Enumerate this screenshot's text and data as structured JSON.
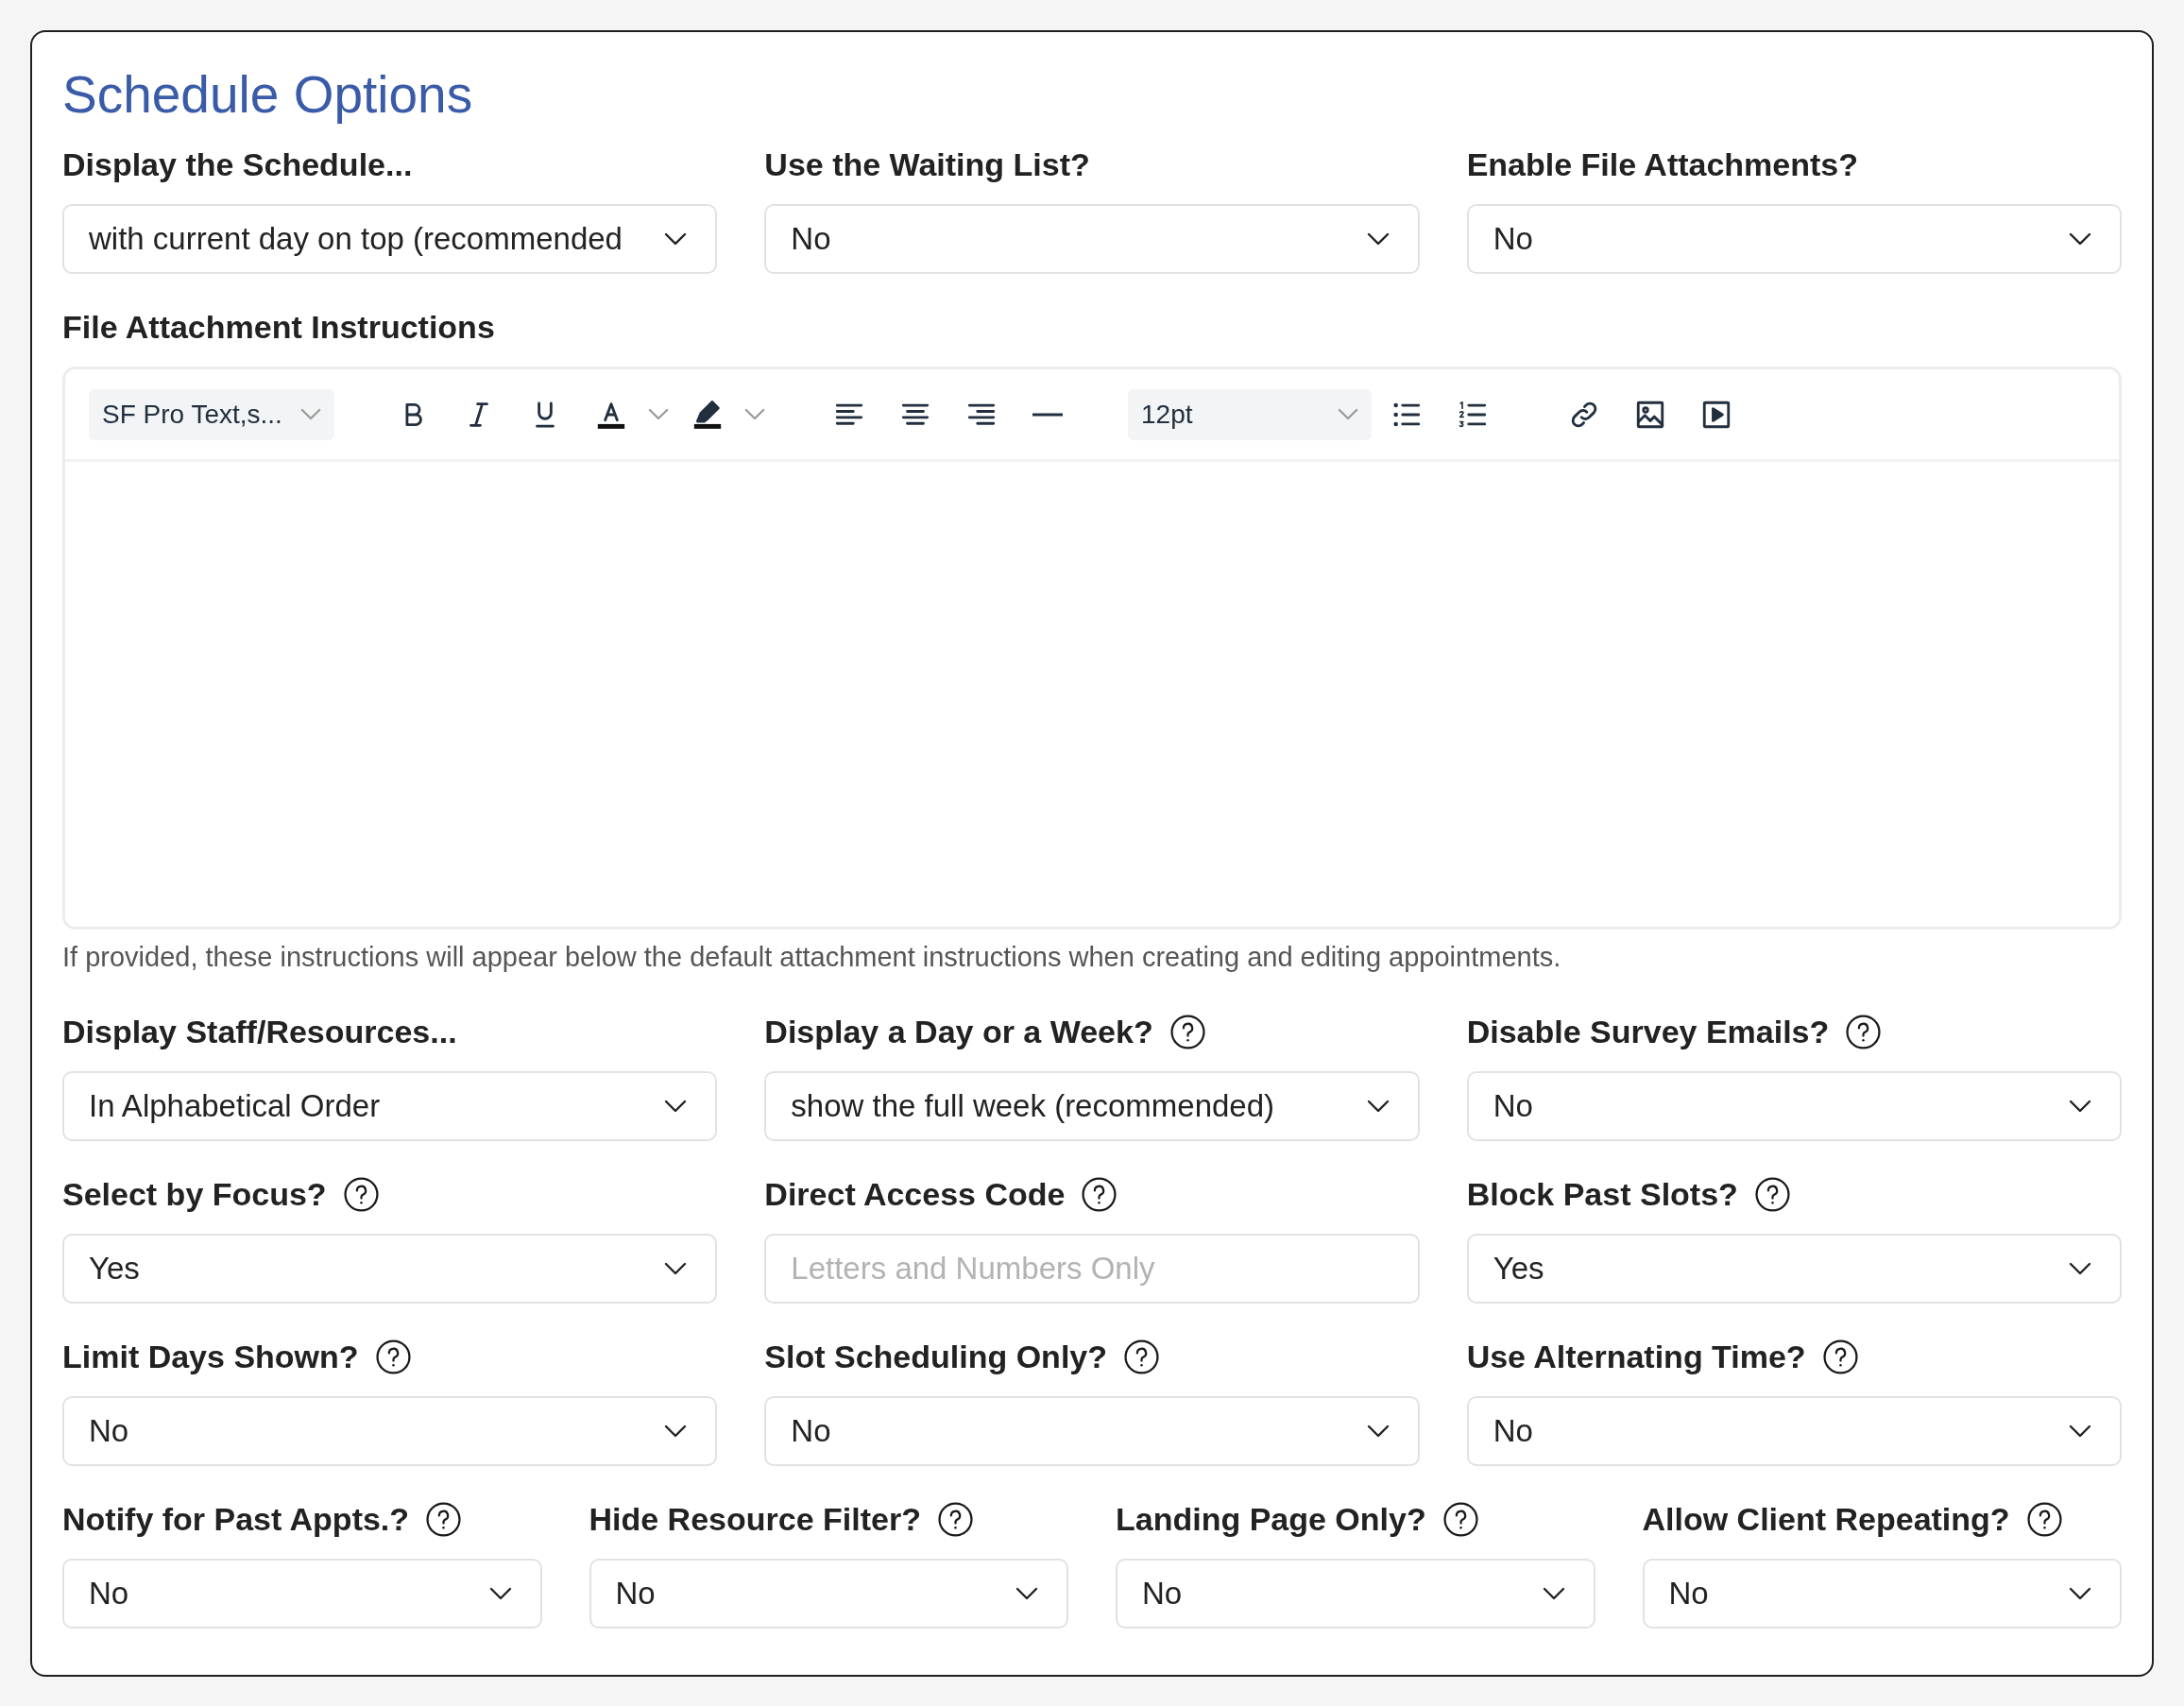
{
  "title": "Schedule Options",
  "rows_above_editor": [
    [
      {
        "kind": "select",
        "label": "Display the Schedule...",
        "help": false,
        "value": "with current day on top (recommended"
      },
      {
        "kind": "select",
        "label": "Use the Waiting List?",
        "help": false,
        "value": "No"
      },
      {
        "kind": "select",
        "label": "Enable File Attachments?",
        "help": false,
        "value": "No"
      }
    ]
  ],
  "editor": {
    "label": "File Attachment Instructions",
    "font_family": "SF Pro Text,s...",
    "font_size": "12pt",
    "hint": "If provided, these instructions will appear below the default attachment instructions when creating and editing appointments."
  },
  "rows_below_editor": [
    [
      {
        "kind": "select",
        "label": "Display Staff/Resources...",
        "help": false,
        "value": "In Alphabetical Order"
      },
      {
        "kind": "select",
        "label": "Display a Day or a Week?",
        "help": true,
        "value": "show the full week (recommended)"
      },
      {
        "kind": "select",
        "label": "Disable Survey Emails?",
        "help": true,
        "value": "No"
      }
    ],
    [
      {
        "kind": "select",
        "label": "Select by Focus?",
        "help": true,
        "value": "Yes"
      },
      {
        "kind": "input",
        "label": "Direct Access Code",
        "help": true,
        "placeholder": "Letters and Numbers Only"
      },
      {
        "kind": "select",
        "label": "Block Past Slots?",
        "help": true,
        "value": "Yes"
      }
    ],
    [
      {
        "kind": "select",
        "label": "Limit Days Shown?",
        "help": true,
        "value": "No"
      },
      {
        "kind": "select",
        "label": "Slot Scheduling Only?",
        "help": true,
        "value": "No"
      },
      {
        "kind": "select",
        "label": "Use Alternating Time?",
        "help": true,
        "value": "No"
      }
    ],
    [
      {
        "kind": "select",
        "label": "Notify for Past Appts.?",
        "help": true,
        "value": "No"
      },
      {
        "kind": "select",
        "label": "Hide Resource Filter?",
        "help": true,
        "value": "No"
      },
      {
        "kind": "select",
        "label": "Landing Page Only?",
        "help": true,
        "value": "No"
      },
      {
        "kind": "select",
        "label": "Allow Client Repeating?",
        "help": true,
        "value": "No"
      }
    ]
  ]
}
